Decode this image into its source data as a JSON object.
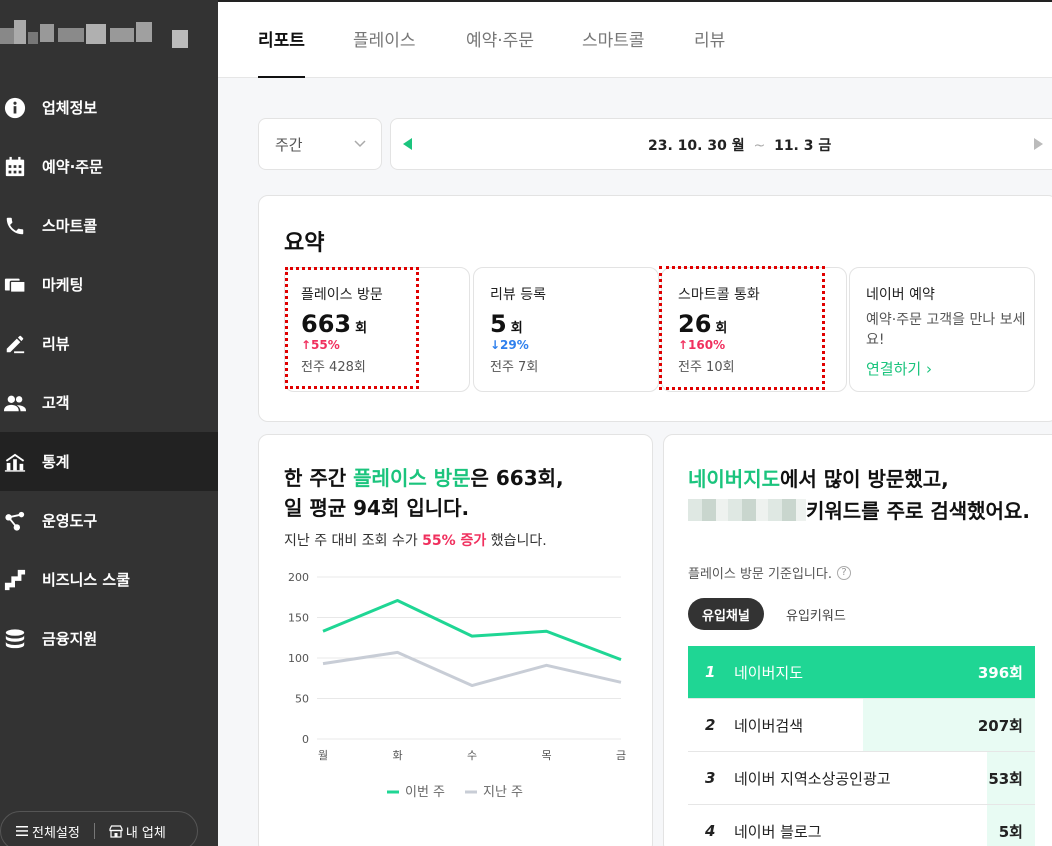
{
  "sidebar": {
    "items": [
      {
        "label": "업체정보",
        "icon": "info-icon",
        "active": false
      },
      {
        "label": "예약·주문",
        "icon": "calendar-icon",
        "active": false
      },
      {
        "label": "스마트콜",
        "icon": "phone-icon",
        "active": false
      },
      {
        "label": "마케팅",
        "icon": "marketing-icon",
        "active": false
      },
      {
        "label": "리뷰",
        "icon": "pencil-icon",
        "active": false
      },
      {
        "label": "고객",
        "icon": "people-icon",
        "active": false
      },
      {
        "label": "통계",
        "icon": "stats-icon",
        "active": true
      },
      {
        "label": "운영도구",
        "icon": "share-icon",
        "active": false
      },
      {
        "label": "비즈니스 스쿨",
        "icon": "stairs-icon",
        "active": false
      },
      {
        "label": "금융지원",
        "icon": "coins-icon",
        "active": false
      }
    ],
    "settings_label": "전체설정",
    "my_store_label": "내 업체"
  },
  "tabs": [
    "리포트",
    "플레이스",
    "예약·주문",
    "스마트콜",
    "리뷰"
  ],
  "period": {
    "selected": "주간",
    "start": "23. 10. 30 월",
    "separator": "~",
    "end": "11. 3 금"
  },
  "summary": {
    "title": "요약",
    "place_visit": {
      "label": "플레이스 방문",
      "value": "663",
      "unit": "회",
      "change": "↑55%",
      "prev": "전주 428회"
    },
    "review": {
      "label": "리뷰 등록",
      "value": "5",
      "unit": "회",
      "change": "↓29%",
      "prev": "전주 7회"
    },
    "smartcall": {
      "label": "스마트콜 통화",
      "value": "26",
      "unit": "회",
      "change": "↑160%",
      "prev": "전주 10회"
    },
    "naver_booking": {
      "label": "네이버 예약",
      "desc": "예약·주문 고객을 만나 보세요!",
      "link": "연결하기 ›"
    }
  },
  "visit_card": {
    "line1_a": "한 주간 ",
    "line1_b": "플레이스 방문",
    "line1_c": "은 663회,",
    "line2": "일 평균 94회 입니다.",
    "sub_a": "지난 주 대비 조회 수가 ",
    "sub_b": "55% 증가",
    "sub_c": " 했습니다."
  },
  "chart_data": {
    "type": "line",
    "categories": [
      "월",
      "화",
      "수",
      "목",
      "금"
    ],
    "series": [
      {
        "name": "이번 주",
        "values": [
          133,
          171,
          127,
          133,
          98
        ],
        "color": "#1fd694"
      },
      {
        "name": "지난 주",
        "values": [
          93,
          107,
          66,
          91,
          70
        ],
        "color": "#c8cdd6"
      }
    ],
    "yticks": [
      0,
      50,
      100,
      150,
      200
    ],
    "ylim": [
      0,
      200
    ],
    "grid": true,
    "legend": "bottom"
  },
  "channel_card": {
    "headline_a": "네이버지도",
    "headline_b": "에서 많이 방문했고,",
    "headline_c": "키워드를 주로 검색했어요.",
    "basis": "플레이스 방문 기준입니다.",
    "pill_active": "유입채널",
    "pill_inactive": "유입키워드",
    "rows": [
      {
        "rank": "1",
        "name": "네이버지도",
        "count": "396회",
        "value": 396
      },
      {
        "rank": "2",
        "name": "네이버검색",
        "count": "207회",
        "value": 207
      },
      {
        "rank": "3",
        "name": "네이버 지역소상공인광고",
        "count": "53회",
        "value": 53
      },
      {
        "rank": "4",
        "name": "네이버 블로그",
        "count": "5회",
        "value": 5
      }
    ]
  }
}
